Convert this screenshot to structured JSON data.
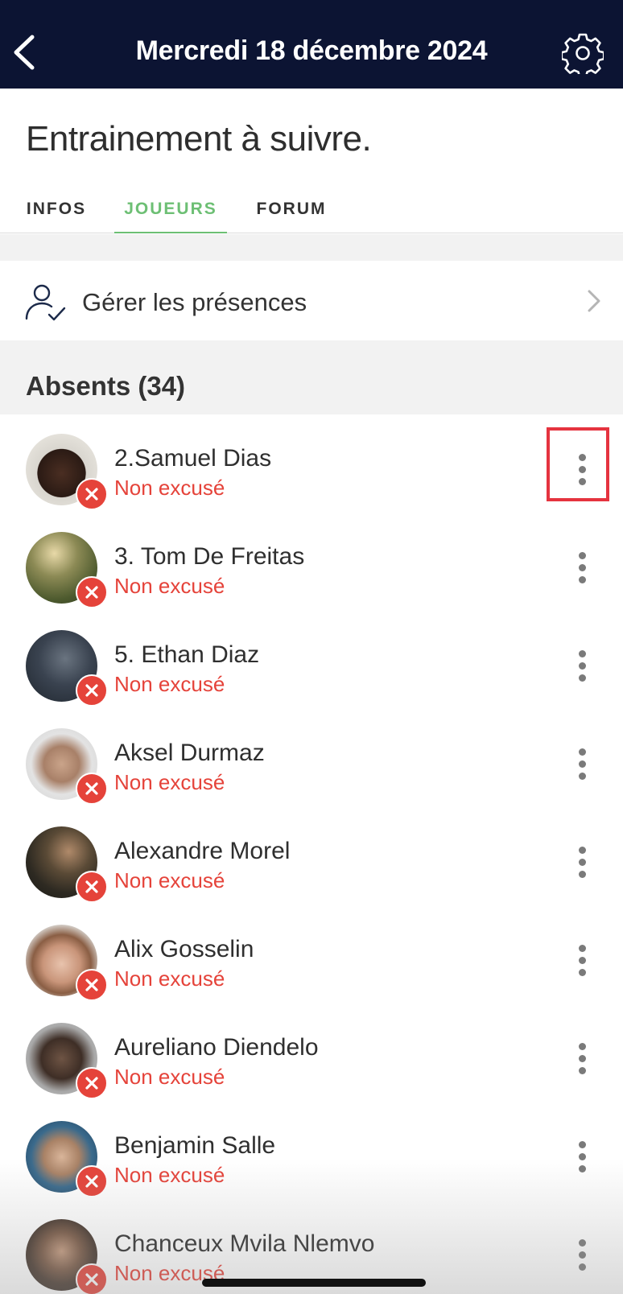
{
  "header": {
    "title": "Mercredi 18 décembre 2024"
  },
  "page": {
    "title": "Entrainement à suivre."
  },
  "tabs": [
    {
      "label": "INFOS",
      "active": false
    },
    {
      "label": "JOUEURS",
      "active": true
    },
    {
      "label": "FORUM",
      "active": false
    }
  ],
  "presence": {
    "label": "Gérer les présences"
  },
  "section": {
    "title": "Absents (34)"
  },
  "players": [
    {
      "name": "2.Samuel Dias",
      "status": "Non excusé"
    },
    {
      "name": "3. Tom De Freitas",
      "status": "Non excusé"
    },
    {
      "name": "5. Ethan Diaz",
      "status": "Non excusé"
    },
    {
      "name": "Aksel Durmaz",
      "status": "Non excusé"
    },
    {
      "name": "Alexandre Morel",
      "status": "Non excusé"
    },
    {
      "name": "Alix Gosselin",
      "status": "Non excusé"
    },
    {
      "name": "Aureliano Diendelo",
      "status": "Non excusé"
    },
    {
      "name": "Benjamin Salle",
      "status": "Non excusé"
    },
    {
      "name": "Chanceux Mvila Nlemvo",
      "status": "Non excusé"
    }
  ],
  "colors": {
    "header_bg": "#0c1433",
    "accent_green": "#6dbf74",
    "absent_red": "#e5433a",
    "highlight_red": "#e5333f"
  }
}
